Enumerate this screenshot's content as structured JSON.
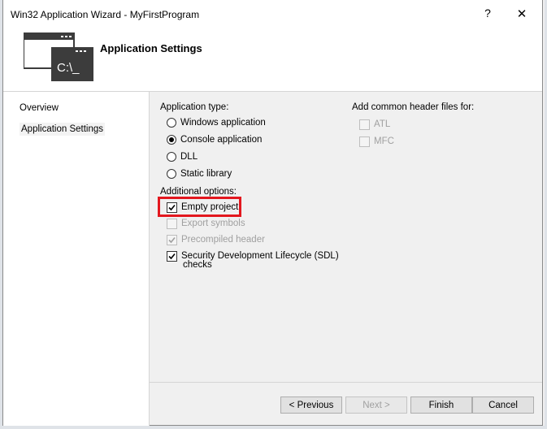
{
  "window": {
    "title": "Win32 Application Wizard - MyFirstProgram",
    "help": "?",
    "close": "✕"
  },
  "header": {
    "title": "Application Settings",
    "logo_text": "C:\\_"
  },
  "nav": {
    "items": [
      {
        "label": "Overview"
      },
      {
        "label": "Application Settings"
      }
    ]
  },
  "app_type": {
    "label": "Application type:",
    "options": [
      {
        "label": "Windows application",
        "selected": false
      },
      {
        "label": "Console application",
        "selected": true
      },
      {
        "label": "DLL",
        "selected": false
      },
      {
        "label": "Static library",
        "selected": false
      }
    ]
  },
  "additional": {
    "label": "Additional options:",
    "empty_project": "Empty project",
    "export_symbols": "Export symbols",
    "precompiled_header": "Precompiled header",
    "sdl_line1": "Security Development Lifecycle (SDL)",
    "sdl_line2": "checks"
  },
  "headers": {
    "label": "Add common header files for:",
    "atl": "ATL",
    "mfc": "MFC"
  },
  "buttons": {
    "previous": "< Previous",
    "next": "Next >",
    "finish": "Finish",
    "cancel": "Cancel"
  },
  "colors": {
    "highlight": "#e3171e",
    "window_bg": "#f0f0f0"
  }
}
